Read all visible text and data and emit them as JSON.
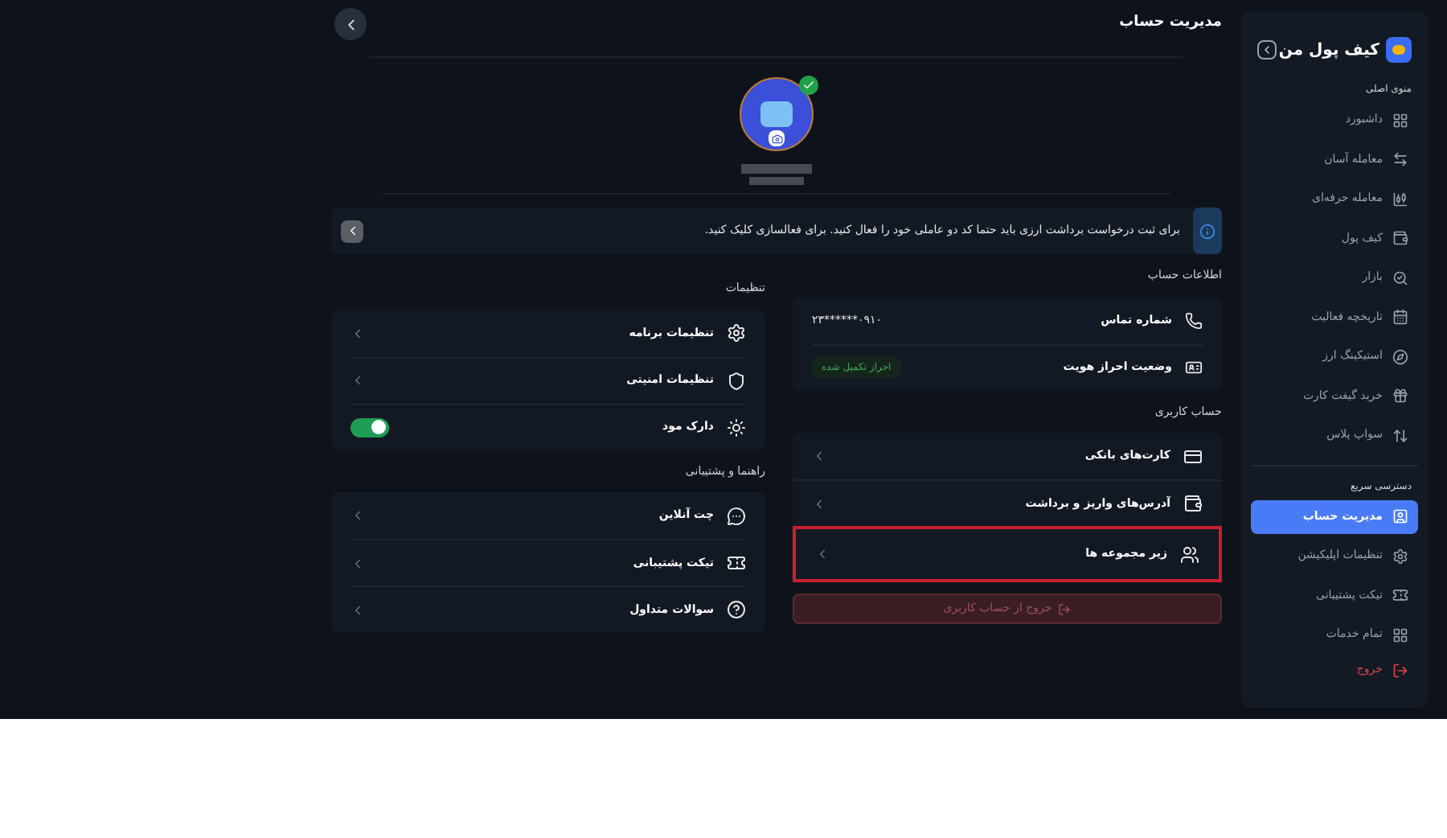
{
  "sidebar": {
    "brand": "کیف پول من",
    "sections": [
      {
        "title": "منوی اصلی",
        "items": [
          {
            "label": "داشبورد",
            "selected": false
          },
          {
            "label": "معامله آسان",
            "selected": false
          },
          {
            "label": "معامله حرفه‌ای",
            "selected": false
          },
          {
            "label": "کیف پول",
            "selected": false
          },
          {
            "label": "بازار",
            "selected": false
          },
          {
            "label": "تاریخچه فعالیت",
            "selected": false
          },
          {
            "label": "استیکینگ ارز",
            "selected": false
          },
          {
            "label": "خرید گیفت کارت",
            "selected": false
          },
          {
            "label": "سواپ پلاس",
            "selected": false
          }
        ]
      },
      {
        "title": "دسترسی سریع",
        "items": [
          {
            "label": "مدیریت حساب",
            "selected": true
          },
          {
            "label": "تنظیمات اپلیکیشن",
            "selected": false
          },
          {
            "label": "تیکت پشتیبانی",
            "selected": false
          },
          {
            "label": "تمام خدمات",
            "selected": false
          }
        ]
      }
    ],
    "logout": "خروج"
  },
  "header": {
    "title": "مدیریت حساب"
  },
  "profile": {
    "verified": true
  },
  "alert": {
    "text": "برای ثبت درخواست برداشت ارزی باید حتما کد دو عاملی خود را فعال کنید. برای فعالسازی کلیک کنید."
  },
  "account_info": {
    "title": "اطلاعات حساب",
    "rows": [
      {
        "label": "شماره تماس",
        "value": "۰۹۱۰******۲۳",
        "kind": "text"
      },
      {
        "label": "وضعیت احراز هویت",
        "value": "احراز تکمیل شده",
        "kind": "badge"
      }
    ]
  },
  "user_account": {
    "title": "حساب کاربری",
    "items": [
      {
        "label": "کارت‌های بانکی",
        "highlighted": false
      },
      {
        "label": "آدرس‌های واریز و برداشت",
        "highlighted": false
      },
      {
        "label": "زیر مجموعه ها",
        "highlighted": true
      }
    ],
    "exit_button": "خروج از حساب کاربری"
  },
  "settings": {
    "title": "تنظیمات",
    "items": [
      {
        "label": "تنظیمات برنامه",
        "kind": "link"
      },
      {
        "label": "تنظیمات امنیتی",
        "kind": "link"
      },
      {
        "label": "دارک مود",
        "kind": "toggle",
        "on": true
      }
    ]
  },
  "help": {
    "title": "راهنما و پشتیبانی",
    "items": [
      {
        "label": "چت آنلاین"
      },
      {
        "label": "تیکت پشتیبانی"
      },
      {
        "label": "سوالات متداول"
      }
    ]
  }
}
